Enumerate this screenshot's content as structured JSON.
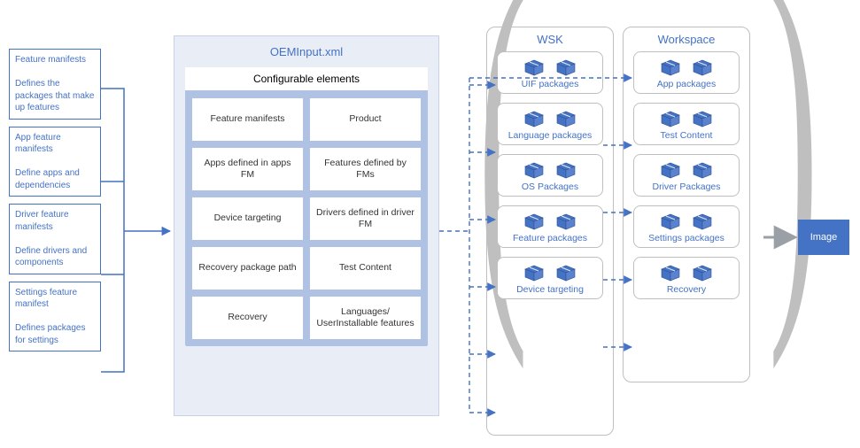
{
  "left": [
    {
      "title": "Feature manifests",
      "desc": "Defines the packages that make up features"
    },
    {
      "title": "App feature manifests",
      "desc": "Define apps and dependencies"
    },
    {
      "title": "Driver feature manifests",
      "desc": "Define drivers and components"
    },
    {
      "title": "Settings feature manifest",
      "desc": "Defines packages for settings"
    }
  ],
  "oem": {
    "title": "OEMInput.xml",
    "config_title": "Configurable elements",
    "cells": [
      "Feature manifests",
      "Product",
      "Apps defined in apps FM",
      "Features defined by FMs",
      "Device targeting",
      "Drivers defined in driver FM",
      "Recovery package path",
      "Test Content",
      "Recovery",
      "Languages/ UserInstallable features"
    ]
  },
  "wsk": {
    "title": "WSK",
    "items": [
      "UIF packages",
      "Language packages",
      "OS Packages",
      "Feature packages",
      "Device targeting"
    ]
  },
  "workspace": {
    "title": "Workspace",
    "items": [
      "App packages",
      "Test Content",
      "Driver Packages",
      "Settings packages",
      "Recovery"
    ]
  },
  "image_label": "Image"
}
